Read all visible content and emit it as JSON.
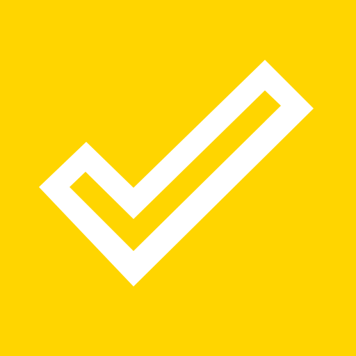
{
  "icon": {
    "name": "checkmark-icon",
    "style": "outlined",
    "background_color": "#FFD500",
    "foreground_color": "#FFFFFF"
  }
}
